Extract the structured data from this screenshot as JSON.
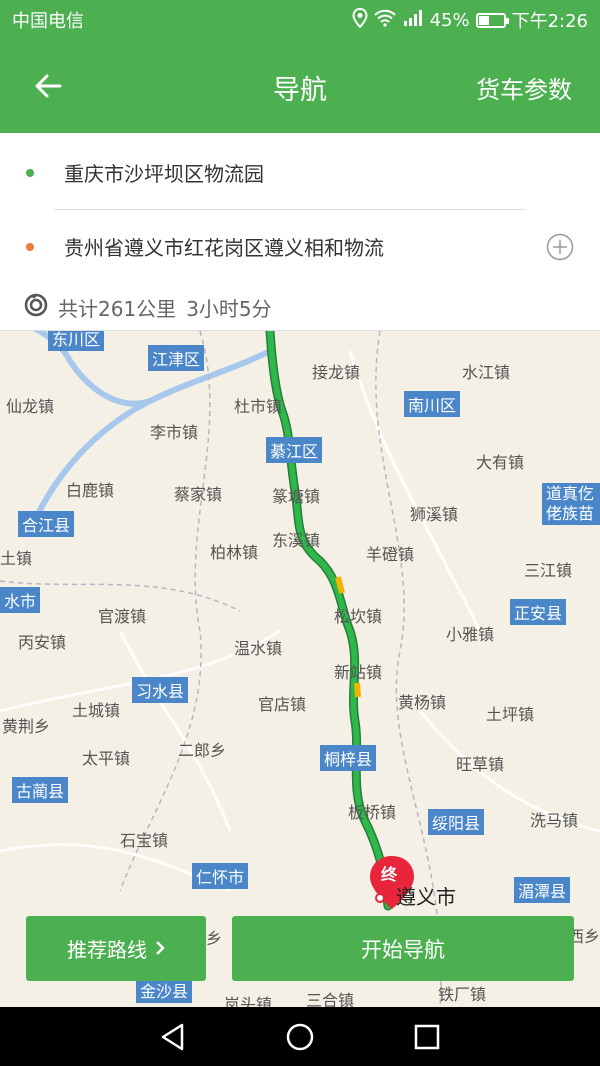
{
  "status": {
    "carrier": "中国电信",
    "battery": "45%",
    "time": "下午2:26",
    "battery_level": 0.45
  },
  "header": {
    "title": "导航",
    "truck_params": "货车参数"
  },
  "route": {
    "origin": "重庆市沙坪坝区物流园",
    "destination": "贵州省遵义市红花岗区遵义相和物流",
    "distance": "共计261公里",
    "duration": "3小时5分"
  },
  "map": {
    "destination_marker": "终",
    "destination_city": "遵义市",
    "place_labels": [
      "仙龙镇",
      "李市镇",
      "白鹿镇",
      "蔡家镇",
      "柏林镇",
      "官渡镇",
      "丙安镇",
      "温水镇",
      "官店镇",
      "土城镇",
      "太平镇",
      "二郎乡",
      "石宝镇",
      "黄荆乡",
      "杜市镇",
      "篆塘镇",
      "东溪镇",
      "松坎镇",
      "新站镇",
      "板桥镇",
      "接龙镇",
      "水江镇",
      "大有镇",
      "狮溪镇",
      "羊磴镇",
      "三江镇",
      "小雅镇",
      "黄杨镇",
      "土坪镇",
      "旺草镇",
      "洗马镇",
      "三合镇",
      "铁厂镇",
      "岚头镇",
      "西乡",
      "乡",
      "土镇"
    ],
    "county_tags": [
      "江津区",
      "綦江区",
      "合江县",
      "习水县",
      "古蔺县",
      "仁怀市",
      "桐梓县",
      "南川区",
      "正安县",
      "绥阳县",
      "湄潭县",
      "金沙县",
      "道真仡佬族苗族自治县",
      "东川区",
      "水市"
    ],
    "colors": {
      "route": "#2db84a",
      "route_slow": "#f0b400",
      "water": "#a7c8ec"
    }
  },
  "actions": {
    "recommend": "推荐路线",
    "start": "开始导航"
  }
}
